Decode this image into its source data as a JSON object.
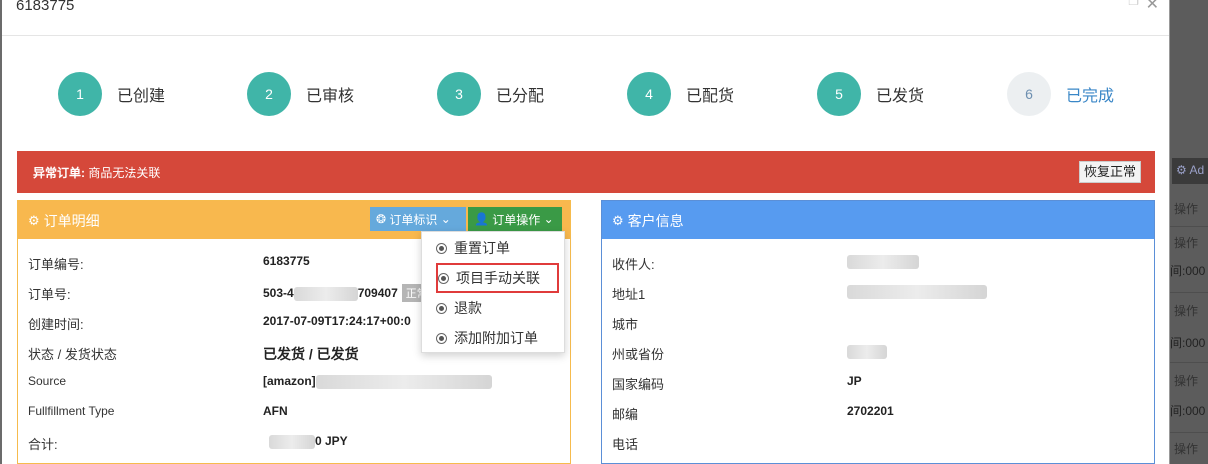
{
  "modal": {
    "title": "6183775"
  },
  "steps": [
    {
      "num": "1",
      "label": "已创建"
    },
    {
      "num": "2",
      "label": "已审核"
    },
    {
      "num": "3",
      "label": "已分配"
    },
    {
      "num": "4",
      "label": "已配货"
    },
    {
      "num": "5",
      "label": "已发货"
    },
    {
      "num": "6",
      "label": "已完成"
    }
  ],
  "alert": {
    "title": "异常订单:",
    "message": "商品无法关联",
    "button": "恢复正常"
  },
  "order_panel": {
    "title": "订单明细",
    "tag_button": "订单标识",
    "op_button": "订单操作",
    "rows": [
      {
        "key": "订单编号:",
        "value": "6183775"
      },
      {
        "key": "订单号:",
        "value_a": "503-4",
        "value_b": "709407",
        "badge": "正常"
      },
      {
        "key": "创建时间:",
        "value": "2017-07-09T17:24:17+00:0"
      },
      {
        "key": "状态 / 发货状态",
        "value": "已发货 / 已发货"
      },
      {
        "key": "Source",
        "value": "[amazon]"
      },
      {
        "key": "Fullfillment Type",
        "value": "AFN"
      },
      {
        "key": "合计:",
        "value": "0 JPY"
      }
    ]
  },
  "dropdown": {
    "items": [
      "重置订单",
      "项目手动关联",
      "退款",
      "添加附加订单"
    ]
  },
  "customer_panel": {
    "title": "客户信息",
    "rows": [
      {
        "key": "收件人:",
        "value": ""
      },
      {
        "key": "地址1",
        "value": ""
      },
      {
        "key": "城市",
        "value": ""
      },
      {
        "key": "州或省份",
        "value": ""
      },
      {
        "key": "国家编码",
        "value": "JP"
      },
      {
        "key": "邮编",
        "value": "2702201"
      },
      {
        "key": "电话",
        "value": ""
      }
    ]
  },
  "background": {
    "ad_label": "Ad",
    "op_label": "操作",
    "op_label2": "操作",
    "time_label": "间:000"
  },
  "colors": {
    "step": "#40b5a8",
    "alert": "#d5483a",
    "order_header": "#f8b84e",
    "customer_header": "#579bf0",
    "highlight": "#e03b3b"
  }
}
